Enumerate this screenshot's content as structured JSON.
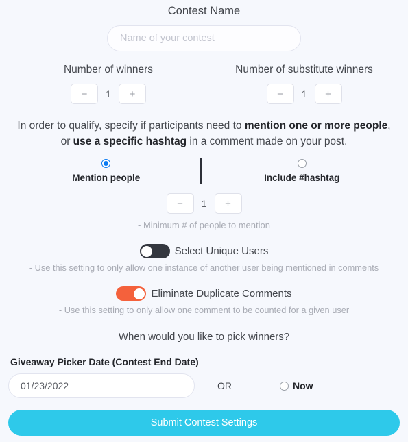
{
  "form": {
    "contest_name_label": "Contest Name",
    "contest_name_placeholder": "Name of your contest",
    "contest_name_value": ""
  },
  "winners": {
    "primary": {
      "title": "Number of winners",
      "decrement_label": "−",
      "increment_label": "+",
      "value": "1"
    },
    "substitute": {
      "title": "Number of substitute winners",
      "decrement_label": "−",
      "increment_label": "+",
      "value": "1"
    }
  },
  "qualify": {
    "part1": "In order to qualify, specify if participants need to ",
    "bold1": "mention one or more people",
    "part2": ", or ",
    "bold2": "use a specific hashtag",
    "part3": " in a comment made on your post."
  },
  "choices": {
    "mention": {
      "label": "Mention people",
      "selected": true
    },
    "hashtag": {
      "label": "Include #hashtag",
      "selected": false
    }
  },
  "mention_count": {
    "decrement_label": "−",
    "increment_label": "+",
    "value": "1",
    "hint": "- Minimum # of people to mention"
  },
  "toggles": {
    "unique_users": {
      "label": "Select Unique Users",
      "state": "off",
      "hint": "- Use this setting to only allow one instance of another user being mentioned in comments"
    },
    "duplicate_comments": {
      "label": "Eliminate Duplicate Comments",
      "state": "on",
      "hint": "- Use this setting to only allow one comment to be counted for a given user"
    }
  },
  "schedule": {
    "question": "When would you like to pick winners?",
    "date_label": "Giveaway Picker Date (Contest End Date)",
    "date_value": "01/23/2022",
    "or_label": "OR",
    "now_label": "Now",
    "now_selected": false
  },
  "submit": {
    "label": "Submit Contest Settings"
  },
  "colors": {
    "background": "#f6f8fd",
    "accent_submit": "#2ec9ea",
    "radio_selected": "#0a7bf2",
    "toggle_on": "#f4613c",
    "toggle_off": "#34373f",
    "hint_text": "#a8abb4"
  }
}
